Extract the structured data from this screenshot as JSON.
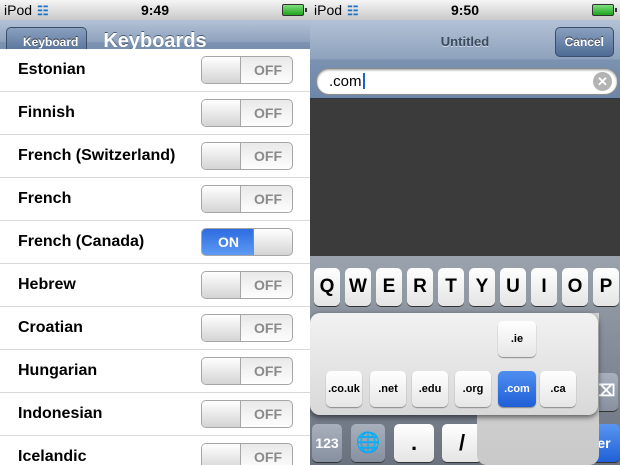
{
  "left": {
    "status": {
      "carrier": "iPod",
      "time": "9:49"
    },
    "nav": {
      "back_label": "Keyboard",
      "title": "Keyboards"
    },
    "rows": [
      {
        "label": "Estonian",
        "state": "OFF",
        "on": false
      },
      {
        "label": "Finnish",
        "state": "OFF",
        "on": false
      },
      {
        "label": "French (Switzerland)",
        "state": "OFF",
        "on": false
      },
      {
        "label": "French",
        "state": "OFF",
        "on": false
      },
      {
        "label": "French (Canada)",
        "state": "ON",
        "on": true
      },
      {
        "label": "Hebrew",
        "state": "OFF",
        "on": false
      },
      {
        "label": "Croatian",
        "state": "OFF",
        "on": false
      },
      {
        "label": "Hungarian",
        "state": "OFF",
        "on": false
      },
      {
        "label": "Indonesian",
        "state": "OFF",
        "on": false
      },
      {
        "label": "Icelandic",
        "state": "OFF",
        "on": false
      }
    ]
  },
  "right": {
    "status": {
      "carrier": "iPod",
      "time": "9:50"
    },
    "nav": {
      "title": "Untitled",
      "cancel_label": "Cancel"
    },
    "url_value": ".com",
    "keys_row1": [
      "Q",
      "W",
      "E",
      "R",
      "T",
      "Y",
      "U",
      "I",
      "O",
      "P"
    ],
    "domain_top": ".ie",
    "domains": [
      ".co.uk",
      ".net",
      ".edu",
      ".org",
      ".com",
      ".ca"
    ],
    "selected_domain": ".com",
    "bottom": {
      "num_label": "123",
      "dot_label": ".",
      "slash_label": "/",
      "go_label": "Accéder"
    }
  },
  "colors": {
    "nav_blue": "#6d86a8",
    "toggle_on": "#2e6be0",
    "key_go": "#1f60d8"
  }
}
